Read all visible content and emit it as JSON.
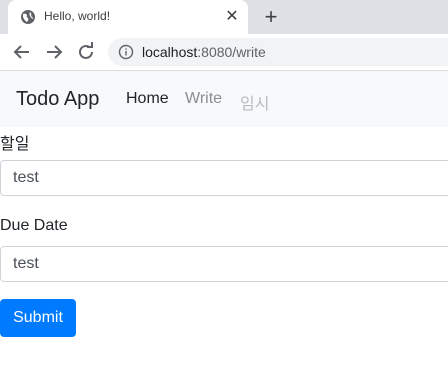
{
  "browser": {
    "tab_title": "Hello, world!",
    "new_tab_icon": "plus-icon",
    "close_icon": "close-icon",
    "url_host": "localhost",
    "url_path": ":8080/write"
  },
  "navbar": {
    "brand": "Todo App",
    "links": [
      {
        "label": "Home",
        "color": "#212529"
      },
      {
        "label": "Write",
        "color": "#8a8d91"
      },
      {
        "label": "임시",
        "color": "#b8bbbe"
      }
    ]
  },
  "form": {
    "todo_label": "할일",
    "todo_value": "test",
    "due_label": "Due Date",
    "due_value": "test",
    "submit_label": "Submit"
  },
  "colors": {
    "primary": "#007bff"
  }
}
